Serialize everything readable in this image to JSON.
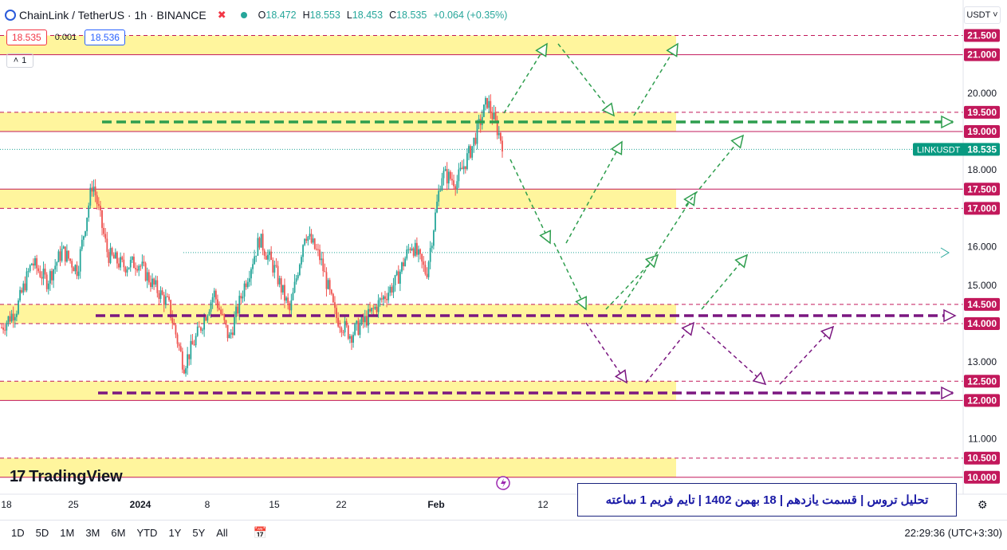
{
  "header": {
    "symbol": "ChainLink / TetherUS · 1h · BINANCE",
    "open": "18.472",
    "high": "18.553",
    "low": "18.453",
    "close": "18.535",
    "change": "+0.064 (+0.35%)",
    "bid": "18.535",
    "spread": "0.001",
    "ask": "18.536",
    "collapse_label": "1",
    "currency": "USDT ˅"
  },
  "branding": {
    "logo_text": "TradingView"
  },
  "caption": "تحلیل تروس | قسمت یازدهم | 18 بهمن 1402 | تایم فریم 1 ساعته",
  "toolbar": {
    "ranges": [
      "1D",
      "5D",
      "1M",
      "3M",
      "6M",
      "YTD",
      "1Y",
      "5Y",
      "All"
    ],
    "clock": "22:29:36 (UTC+3:30)"
  },
  "colors": {
    "up": "#26a69a",
    "down": "#ef5350",
    "zone": "#fff59d",
    "green_arrow": "#2e9e4e",
    "purple_arrow": "#7b1780",
    "level_line": "#c2185b"
  },
  "chart_data": {
    "type": "candlestick",
    "title": "LINKUSDT 1h",
    "last_price": "18.535",
    "last_price_label": "LINKUSDT",
    "y_ticks": [
      {
        "v": 21.5,
        "label": "21.500",
        "hl": true
      },
      {
        "v": 21.0,
        "label": "21.000",
        "hl": true
      },
      {
        "v": 20.0,
        "label": "20.000",
        "hl": false
      },
      {
        "v": 19.5,
        "label": "19.500",
        "hl": true
      },
      {
        "v": 19.0,
        "label": "19.000",
        "hl": true
      },
      {
        "v": 18.0,
        "label": "18.000",
        "hl": false
      },
      {
        "v": 17.5,
        "label": "17.500",
        "hl": true
      },
      {
        "v": 17.0,
        "label": "17.000",
        "hl": true
      },
      {
        "v": 16.0,
        "label": "16.000",
        "hl": false
      },
      {
        "v": 15.0,
        "label": "15.000",
        "hl": false
      },
      {
        "v": 14.5,
        "label": "14.500",
        "hl": true
      },
      {
        "v": 14.0,
        "label": "14.000",
        "hl": true
      },
      {
        "v": 13.0,
        "label": "13.000",
        "hl": false
      },
      {
        "v": 12.5,
        "label": "12.500",
        "hl": true
      },
      {
        "v": 12.0,
        "label": "12.000",
        "hl": true
      },
      {
        "v": 11.0,
        "label": "11.000",
        "hl": false
      },
      {
        "v": 10.5,
        "label": "10.500",
        "hl": true
      },
      {
        "v": 10.0,
        "label": "10.000",
        "hl": true
      }
    ],
    "x_ticks": [
      {
        "label": "18",
        "bold": false
      },
      {
        "label": "25",
        "bold": false
      },
      {
        "label": "2024",
        "bold": true
      },
      {
        "label": "8",
        "bold": false
      },
      {
        "label": "15",
        "bold": false
      },
      {
        "label": "22",
        "bold": false
      },
      {
        "label": "Feb",
        "bold": true
      },
      {
        "label": "12",
        "bold": false
      }
    ],
    "zones": [
      [
        21.0,
        21.5
      ],
      [
        19.0,
        19.5
      ],
      [
        17.0,
        17.5
      ],
      [
        14.0,
        14.5
      ],
      [
        12.0,
        12.5
      ],
      [
        10.0,
        10.5
      ]
    ],
    "solid_levels": [
      21.0,
      19.0,
      17.5,
      12.0,
      10.0
    ],
    "dashed_levels": [
      21.5,
      19.5,
      17.0,
      14.5,
      14.0,
      12.5,
      10.5
    ],
    "mid_level": 15.85,
    "price_path": [
      [
        13.9,
        14.3
      ],
      [
        14.4,
        14.7
      ],
      [
        15.6,
        15.9
      ],
      [
        15.1,
        15.4
      ],
      [
        15.9,
        16.2
      ],
      [
        15.4,
        15.6
      ],
      [
        17.7,
        17.5
      ],
      [
        15.8,
        15.9
      ],
      [
        15.5,
        15.2
      ],
      [
        15.6,
        15.9
      ],
      [
        15.0,
        14.9
      ],
      [
        14.5,
        14.3
      ],
      [
        12.9,
        13.1
      ],
      [
        13.8,
        13.6
      ],
      [
        14.8,
        15.1
      ],
      [
        13.6,
        13.9
      ],
      [
        15.0,
        15.3
      ],
      [
        16.2,
        16.0
      ],
      [
        15.4,
        15.2
      ],
      [
        14.3,
        14.2
      ],
      [
        16.4,
        16.6
      ],
      [
        15.7,
        15.8
      ],
      [
        14.2,
        14.4
      ],
      [
        13.7,
        13.5
      ],
      [
        14.1,
        14.3
      ],
      [
        14.6,
        14.9
      ],
      [
        15.1,
        15.4
      ],
      [
        16.1,
        16.0
      ],
      [
        15.3,
        15.5
      ],
      [
        17.9,
        18.1
      ],
      [
        17.7,
        17.6
      ],
      [
        18.6,
        18.7
      ],
      [
        19.8,
        19.5
      ],
      [
        18.7,
        18.5
      ]
    ]
  }
}
